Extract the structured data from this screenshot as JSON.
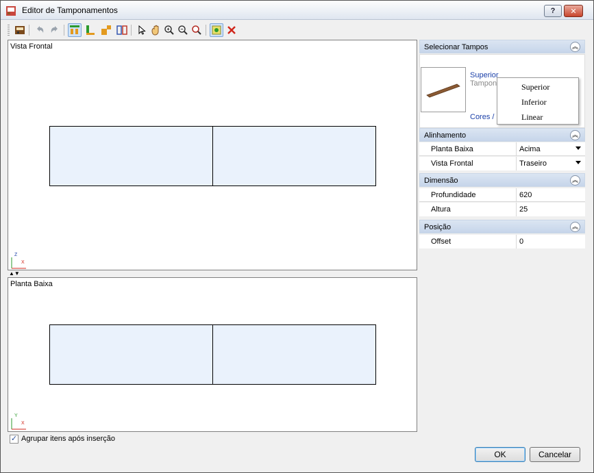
{
  "window": {
    "title": "Editor de Tamponamentos",
    "help_button": "?",
    "close_button": "✕"
  },
  "toolbar": {
    "items": [
      {
        "name": "tampon-tool-icon"
      },
      {
        "name": "undo-icon"
      },
      {
        "name": "redo-icon"
      },
      {
        "name": "layout-top-icon"
      },
      {
        "name": "layout-bottom-icon"
      },
      {
        "name": "layout-side-icon"
      },
      {
        "name": "split-view-icon"
      },
      {
        "name": "pointer-icon"
      },
      {
        "name": "pan-hand-icon"
      },
      {
        "name": "zoom-in-icon"
      },
      {
        "name": "zoom-out-icon"
      },
      {
        "name": "zoom-fit-icon"
      },
      {
        "name": "add-tampon-icon"
      },
      {
        "name": "delete-icon"
      }
    ]
  },
  "views": {
    "front": {
      "label": "Vista Frontal",
      "axis_up": "Z",
      "axis_right": "X"
    },
    "plan": {
      "label": "Planta Baixa",
      "axis_up": "Y",
      "axis_right": "X"
    }
  },
  "side_panel": {
    "selecionar": {
      "title": "Selecionar Tampos",
      "selected_link": "Superior",
      "subtitle": "Tampon",
      "cores_link": "Cores /",
      "dropdown_options": [
        "Superior",
        "Inferior",
        "Linear"
      ]
    },
    "alinhamento": {
      "title": "Alinhamento",
      "rows": [
        {
          "name": "Planta Baixa",
          "value": "Acima"
        },
        {
          "name": "Vista Frontal",
          "value": "Traseiro"
        }
      ]
    },
    "dimensao": {
      "title": "Dimensão",
      "rows": [
        {
          "name": "Profundidade",
          "value": "620"
        },
        {
          "name": "Altura",
          "value": "25"
        }
      ]
    },
    "posicao": {
      "title": "Posição",
      "rows": [
        {
          "name": "Offset",
          "value": "0"
        }
      ]
    }
  },
  "footer": {
    "group_checkbox_label": "Agrupar itens após inserção",
    "group_checked": true,
    "ok_label": "OK",
    "cancel_label": "Cancelar"
  },
  "colors": {
    "panel_fill": "#eaf2fc",
    "section_header": "#c6d5ea",
    "link": "#1a3fa8",
    "close_red": "#c8452d"
  }
}
